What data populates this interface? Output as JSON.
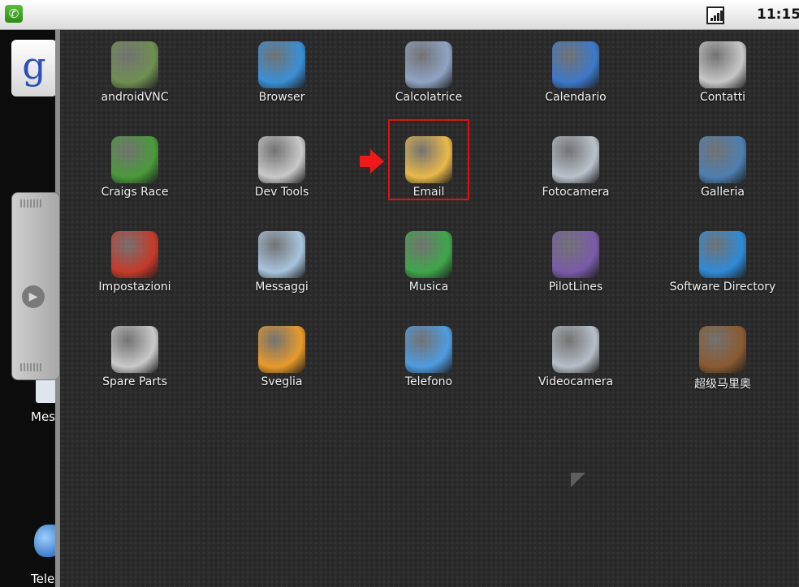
{
  "status_bar": {
    "time": "11:15"
  },
  "home": {
    "msg_label": "Mes",
    "tel_label": "Tele"
  },
  "drawer": {
    "apps": [
      {
        "label": "androidVNC",
        "icon": "vnc-icon",
        "color": "#6f8f52"
      },
      {
        "label": "Browser",
        "icon": "globe-icon",
        "color": "#3a8fd6"
      },
      {
        "label": "Calcolatrice",
        "icon": "calculator-icon",
        "color": "#8fa3c4"
      },
      {
        "label": "Calendario",
        "icon": "calendar-icon",
        "color": "#3d78c9"
      },
      {
        "label": "Contatti",
        "icon": "contacts-icon",
        "color": "#c7c7c7"
      },
      {
        "label": "Craigs Race",
        "icon": "race-icon",
        "color": "#4a9a3a"
      },
      {
        "label": "Dev Tools",
        "icon": "gear-icon",
        "color": "#c9c9c9"
      },
      {
        "label": "Email",
        "icon": "envelope-icon",
        "color": "#e9b94a"
      },
      {
        "label": "Fotocamera",
        "icon": "camera-icon",
        "color": "#b9c2cc"
      },
      {
        "label": "Galleria",
        "icon": "gallery-icon",
        "color": "#4e7fb0"
      },
      {
        "label": "Impostazioni",
        "icon": "settings-icon",
        "color": "#c63a2a"
      },
      {
        "label": "Messaggi",
        "icon": "messages-icon",
        "color": "#a8c4de"
      },
      {
        "label": "Musica",
        "icon": "music-icon",
        "color": "#3fa64a"
      },
      {
        "label": "PilotLines",
        "icon": "pilotlines-icon",
        "color": "#7a5ba8"
      },
      {
        "label": "Software Directory",
        "icon": "software-directory-icon",
        "color": "#2f8ad8"
      },
      {
        "label": "Spare Parts",
        "icon": "gear-icon",
        "color": "#c9c9c9"
      },
      {
        "label": "Sveglia",
        "icon": "alarm-clock-icon",
        "color": "#e89a2a"
      },
      {
        "label": "Telefono",
        "icon": "phone-icon",
        "color": "#4f9be0"
      },
      {
        "label": "Videocamera",
        "icon": "video-camera-icon",
        "color": "#b6bec8"
      },
      {
        "label": "超级马里奥",
        "icon": "mario-icon",
        "color": "#8a5a30"
      }
    ]
  }
}
